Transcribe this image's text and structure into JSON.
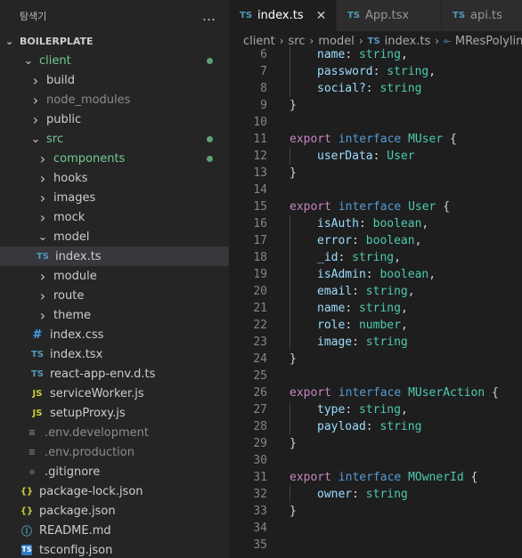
{
  "explorer": {
    "title": "탐색기",
    "more_icon": "…",
    "section": "BOILERPLATE",
    "tree": [
      {
        "label": "client",
        "kind": "folder",
        "open": true,
        "depth": 1,
        "color": "green",
        "dot": true
      },
      {
        "label": "build",
        "kind": "folder",
        "open": false,
        "depth": 2
      },
      {
        "label": "node_modules",
        "kind": "folder",
        "open": false,
        "depth": 2,
        "color": "muted"
      },
      {
        "label": "public",
        "kind": "folder",
        "open": false,
        "depth": 2
      },
      {
        "label": "src",
        "kind": "folder",
        "open": true,
        "depth": 2,
        "color": "green",
        "dot": true
      },
      {
        "label": "components",
        "kind": "folder",
        "open": false,
        "depth": 3,
        "color": "green",
        "dot": true
      },
      {
        "label": "hooks",
        "kind": "folder",
        "open": false,
        "depth": 3
      },
      {
        "label": "images",
        "kind": "folder",
        "open": false,
        "depth": 3
      },
      {
        "label": "mock",
        "kind": "folder",
        "open": false,
        "depth": 3
      },
      {
        "label": "model",
        "kind": "folder",
        "open": true,
        "depth": 3
      },
      {
        "label": "index.ts",
        "kind": "file",
        "icon": "TS",
        "depth": 4,
        "selected": true
      },
      {
        "label": "module",
        "kind": "folder",
        "open": false,
        "depth": 3
      },
      {
        "label": "route",
        "kind": "folder",
        "open": false,
        "depth": 3
      },
      {
        "label": "theme",
        "kind": "folder",
        "open": false,
        "depth": 3
      },
      {
        "label": "index.css",
        "kind": "file",
        "icon": "#",
        "depth": 3
      },
      {
        "label": "index.tsx",
        "kind": "file",
        "icon": "TS",
        "depth": 3
      },
      {
        "label": "react-app-env.d.ts",
        "kind": "file",
        "icon": "TS",
        "depth": 3
      },
      {
        "label": "serviceWorker.js",
        "kind": "file",
        "icon": "JS",
        "depth": 3
      },
      {
        "label": "setupProxy.js",
        "kind": "file",
        "icon": "JS",
        "depth": 3
      },
      {
        "label": ".env.development",
        "kind": "file",
        "icon": "≡",
        "depth": 2,
        "color": "muted"
      },
      {
        "label": ".env.production",
        "kind": "file",
        "icon": "≡",
        "depth": 2,
        "color": "muted"
      },
      {
        "label": ".gitignore",
        "kind": "file",
        "icon": "◆",
        "depth": 2
      },
      {
        "label": "package-lock.json",
        "kind": "file",
        "icon": "{}",
        "depth": 1
      },
      {
        "label": "package.json",
        "kind": "file",
        "icon": "{}",
        "depth": 1
      },
      {
        "label": "README.md",
        "kind": "file",
        "icon": "ⓘ",
        "depth": 1
      },
      {
        "label": "tsconfig.json",
        "kind": "file",
        "icon": "TS",
        "depth": 1,
        "tsconfig": true
      }
    ]
  },
  "tabs": [
    {
      "label": "index.ts",
      "icon": "TS",
      "active": true,
      "close": "✕"
    },
    {
      "label": "App.tsx",
      "icon": "TS",
      "active": false
    },
    {
      "label": "api.ts",
      "icon": "TS",
      "active": false
    }
  ],
  "breadcrumb": {
    "items": [
      "client",
      "src",
      "model"
    ],
    "file_icon": "TS",
    "file": "index.ts",
    "symbol_icon": "⟜",
    "symbol": "MResPolyline",
    "separator": "›"
  },
  "code": [
    {
      "n": "6",
      "i": 1,
      "t": [
        [
          "pr",
          "name"
        ],
        [
          "pu",
          ": "
        ],
        [
          "ty",
          "string"
        ],
        [
          "pu",
          ","
        ]
      ]
    },
    {
      "n": "7",
      "i": 1,
      "t": [
        [
          "pr",
          "password"
        ],
        [
          "pu",
          ": "
        ],
        [
          "ty",
          "string"
        ],
        [
          "pu",
          ","
        ]
      ]
    },
    {
      "n": "8",
      "i": 1,
      "t": [
        [
          "pr",
          "social?"
        ],
        [
          "pu",
          ": "
        ],
        [
          "ty",
          "string"
        ]
      ]
    },
    {
      "n": "9",
      "i": 0,
      "t": [
        [
          "pu",
          "}"
        ]
      ]
    },
    {
      "n": "10",
      "i": 0,
      "t": []
    },
    {
      "n": "11",
      "i": 0,
      "t": [
        [
          "kw",
          "export"
        ],
        [
          "pu",
          " "
        ],
        [
          "kw2",
          "interface"
        ],
        [
          "pu",
          " "
        ],
        [
          "ty",
          "MUser"
        ],
        [
          "pu",
          " {"
        ]
      ]
    },
    {
      "n": "12",
      "i": 1,
      "t": [
        [
          "pr",
          "userData"
        ],
        [
          "pu",
          ": "
        ],
        [
          "ty",
          "User"
        ]
      ]
    },
    {
      "n": "13",
      "i": 0,
      "t": [
        [
          "pu",
          "}"
        ]
      ]
    },
    {
      "n": "14",
      "i": 0,
      "t": []
    },
    {
      "n": "15",
      "i": 0,
      "t": [
        [
          "kw",
          "export"
        ],
        [
          "pu",
          " "
        ],
        [
          "kw2",
          "interface"
        ],
        [
          "pu",
          " "
        ],
        [
          "ty",
          "User"
        ],
        [
          "pu",
          " {"
        ]
      ]
    },
    {
      "n": "16",
      "i": 1,
      "t": [
        [
          "pr",
          "isAuth"
        ],
        [
          "pu",
          ": "
        ],
        [
          "ty",
          "boolean"
        ],
        [
          "pu",
          ","
        ]
      ]
    },
    {
      "n": "17",
      "i": 1,
      "t": [
        [
          "pr",
          "error"
        ],
        [
          "pu",
          ": "
        ],
        [
          "ty",
          "boolean"
        ],
        [
          "pu",
          ","
        ]
      ]
    },
    {
      "n": "18",
      "i": 1,
      "t": [
        [
          "pr",
          "_id"
        ],
        [
          "pu",
          ": "
        ],
        [
          "ty",
          "string"
        ],
        [
          "pu",
          ","
        ]
      ]
    },
    {
      "n": "19",
      "i": 1,
      "t": [
        [
          "pr",
          "isAdmin"
        ],
        [
          "pu",
          ": "
        ],
        [
          "ty",
          "boolean"
        ],
        [
          "pu",
          ","
        ]
      ]
    },
    {
      "n": "20",
      "i": 1,
      "t": [
        [
          "pr",
          "email"
        ],
        [
          "pu",
          ": "
        ],
        [
          "ty",
          "string"
        ],
        [
          "pu",
          ","
        ]
      ]
    },
    {
      "n": "21",
      "i": 1,
      "t": [
        [
          "pr",
          "name"
        ],
        [
          "pu",
          ": "
        ],
        [
          "ty",
          "string"
        ],
        [
          "pu",
          ","
        ]
      ]
    },
    {
      "n": "22",
      "i": 1,
      "t": [
        [
          "pr",
          "role"
        ],
        [
          "pu",
          ": "
        ],
        [
          "ty",
          "number"
        ],
        [
          "pu",
          ","
        ]
      ]
    },
    {
      "n": "23",
      "i": 1,
      "t": [
        [
          "pr",
          "image"
        ],
        [
          "pu",
          ": "
        ],
        [
          "ty",
          "string"
        ]
      ]
    },
    {
      "n": "24",
      "i": 0,
      "t": [
        [
          "pu",
          "}"
        ]
      ]
    },
    {
      "n": "25",
      "i": 0,
      "t": []
    },
    {
      "n": "26",
      "i": 0,
      "t": [
        [
          "kw",
          "export"
        ],
        [
          "pu",
          " "
        ],
        [
          "kw2",
          "interface"
        ],
        [
          "pu",
          " "
        ],
        [
          "ty",
          "MUserAction"
        ],
        [
          "pu",
          " {"
        ]
      ]
    },
    {
      "n": "27",
      "i": 1,
      "t": [
        [
          "pr",
          "type"
        ],
        [
          "pu",
          ": "
        ],
        [
          "ty",
          "string"
        ],
        [
          "pu",
          ","
        ]
      ]
    },
    {
      "n": "28",
      "i": 1,
      "t": [
        [
          "pr",
          "payload"
        ],
        [
          "pu",
          ": "
        ],
        [
          "ty",
          "string"
        ]
      ]
    },
    {
      "n": "29",
      "i": 0,
      "t": [
        [
          "pu",
          "}"
        ]
      ]
    },
    {
      "n": "30",
      "i": 0,
      "t": []
    },
    {
      "n": "31",
      "i": 0,
      "t": [
        [
          "kw",
          "export"
        ],
        [
          "pu",
          " "
        ],
        [
          "kw2",
          "interface"
        ],
        [
          "pu",
          " "
        ],
        [
          "ty",
          "MOwnerId"
        ],
        [
          "pu",
          " {"
        ]
      ]
    },
    {
      "n": "32",
      "i": 1,
      "t": [
        [
          "pr",
          "owner"
        ],
        [
          "pu",
          ": "
        ],
        [
          "ty",
          "string"
        ]
      ]
    },
    {
      "n": "33",
      "i": 0,
      "t": [
        [
          "pu",
          "}"
        ]
      ]
    },
    {
      "n": "34",
      "i": 0,
      "t": []
    },
    {
      "n": "35",
      "i": 0,
      "t": []
    }
  ],
  "colors": {
    "editor_bg": "#1e1e1e",
    "sidebar_bg": "#252526",
    "keyword": "#c586c0",
    "keyword_interface": "#569cd6",
    "type": "#4ec9b0",
    "property": "#9cdcfe",
    "git_modified": "#73c991"
  }
}
